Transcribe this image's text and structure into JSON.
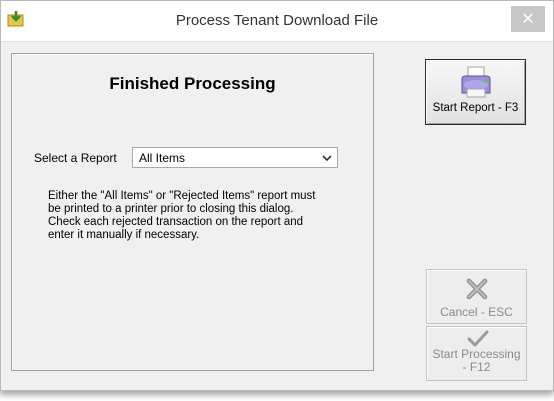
{
  "window": {
    "title": "Process Tenant Download File",
    "close_glyph": "✕",
    "app_icon": "arrow-folder-icon"
  },
  "panel": {
    "heading": "Finished Processing",
    "select_label": "Select a Report",
    "select_value": "All Items",
    "info_text": "Either the \"All Items\" or \"Rejected Items\" report must be printed to a printer prior to closing this dialog. Check each rejected transaction on the report and enter it manually if necessary."
  },
  "buttons": {
    "start_report": {
      "label": "Start Report - F3",
      "icon": "printer-icon",
      "enabled": true
    },
    "cancel": {
      "label": "Cancel - ESC",
      "icon": "x-icon",
      "enabled": false
    },
    "start_processing": {
      "label_line1": "Start Processing",
      "label_line2": "- F12",
      "icon": "checkmark-icon",
      "enabled": false
    }
  }
}
